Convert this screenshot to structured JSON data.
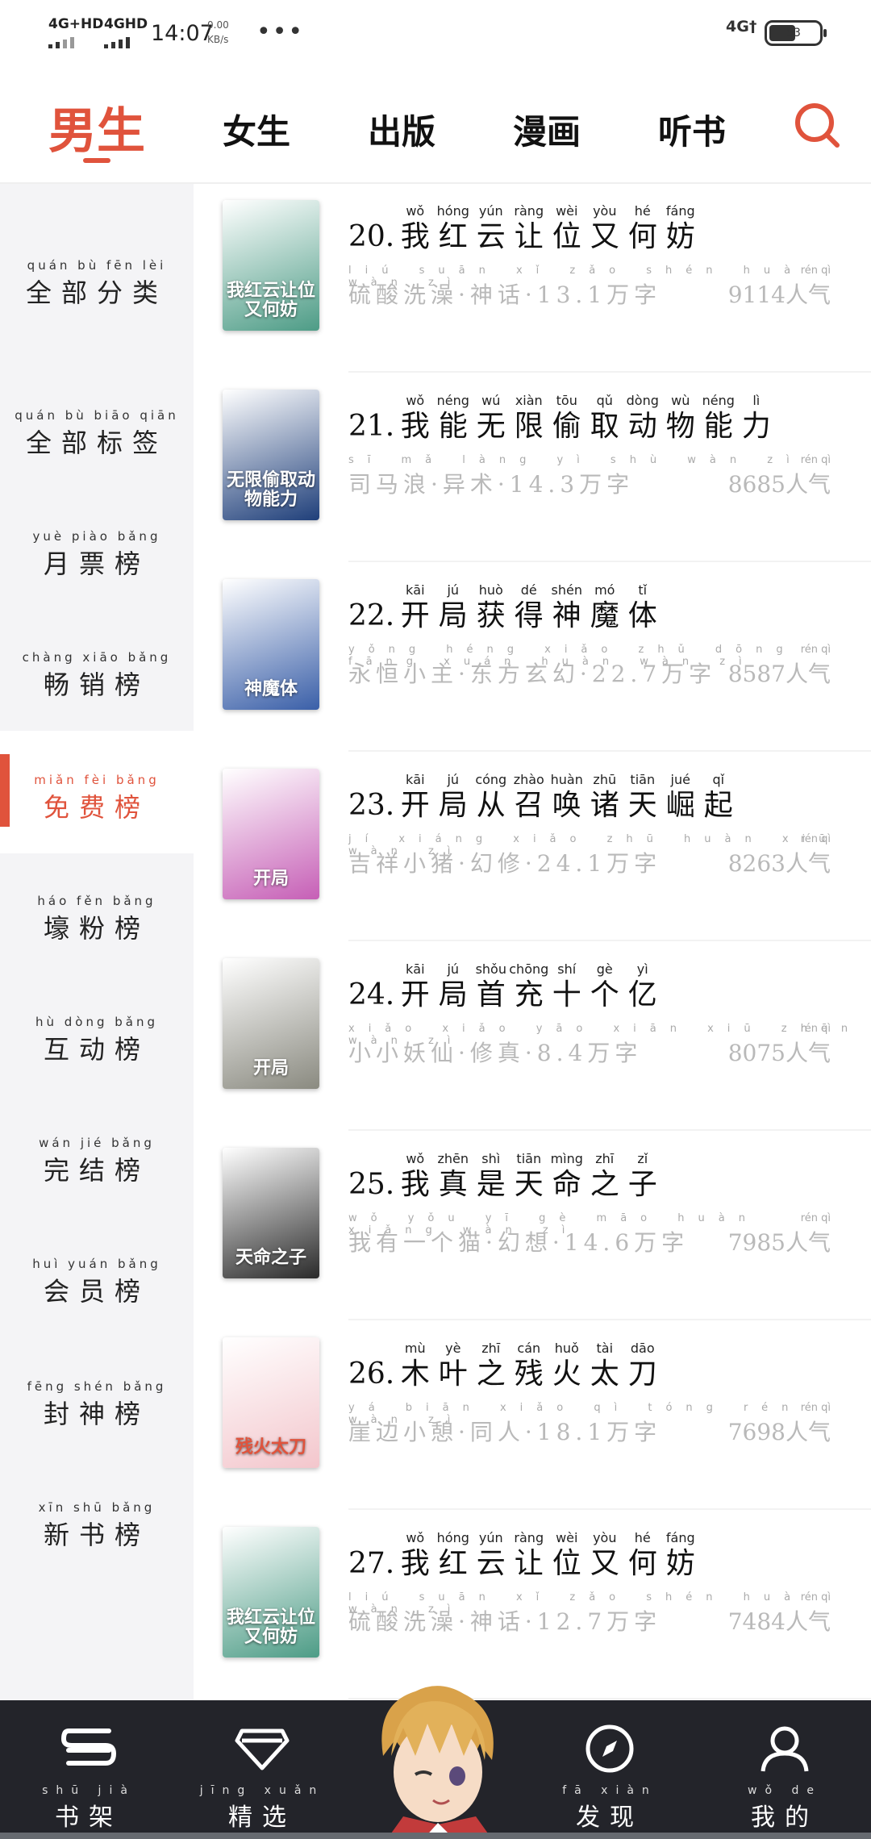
{
  "status_bar": {
    "net1": "4G+HD",
    "net2": "4GHD",
    "time": "14:07",
    "speed_value": "0.00",
    "speed_unit": "KB/s",
    "more": "•••",
    "mobile": "4G†",
    "battery": "53",
    "battery_level": 0.53
  },
  "tabs": [
    {
      "label": "男生"
    },
    {
      "label": "女生"
    },
    {
      "label": "出版"
    },
    {
      "label": "漫画"
    },
    {
      "label": "听书"
    }
  ],
  "sidebar": {
    "items": [
      {
        "pinyin": "quán bù fēn lèi",
        "label": "全部分类"
      },
      {
        "pinyin": "quán bù biāo qiān",
        "label": "全部标签"
      },
      {
        "pinyin": "yuè piào bǎng",
        "label": "月票榜"
      },
      {
        "pinyin": "chàng xiāo bǎng",
        "label": "畅销榜"
      },
      {
        "pinyin": "miǎn fèi bǎng",
        "label": "免费榜"
      },
      {
        "pinyin": "háo fěn bǎng",
        "label": "壕粉榜"
      },
      {
        "pinyin": "hù dòng bǎng",
        "label": "互动榜"
      },
      {
        "pinyin": "wán jié bǎng",
        "label": "完结榜"
      },
      {
        "pinyin": "huì yuán bǎng",
        "label": "会员榜"
      },
      {
        "pinyin": "fēng shén bǎng",
        "label": "封神榜"
      },
      {
        "pinyin": "xīn shū bǎng",
        "label": "新书榜"
      }
    ]
  },
  "books": [
    {
      "num": "20.",
      "title": "我红云让位又何妨",
      "title_py": [
        "wǒ",
        "hóng",
        "yún",
        "ràng",
        "wèi",
        "yòu",
        "hé",
        "fáng"
      ],
      "meta": "硫酸洗澡·神话·13.1万字",
      "meta_py": "liú suān xǐ zǎo shén huà wàn zì",
      "pop": "9114人气",
      "pop_py": "rén qì",
      "cover_text": "我红云让位又何妨",
      "cover_color": "#4d9c86"
    },
    {
      "num": "21.",
      "title": "我能无限偷取动物能力",
      "title_py": [
        "wǒ",
        "néng",
        "wú",
        "xiàn",
        "tōu",
        "qǔ",
        "dòng",
        "wù",
        "néng",
        "lì"
      ],
      "meta": "司马浪·异术·14.3万字",
      "meta_py": "sī mǎ làng yì shù wàn zì",
      "pop": "8685人气",
      "pop_py": "rén qì",
      "cover_text": "无限偷取动物能力",
      "cover_color": "#1f3f7a"
    },
    {
      "num": "22.",
      "title": "开局获得神魔体",
      "title_py": [
        "kāi",
        "jú",
        "huò",
        "dé",
        "shén",
        "mó",
        "tǐ"
      ],
      "meta": "永恒小主·东方玄幻·22.7万字",
      "meta_py": "yǒng héng xiǎo zhǔ dōng fāng xuán huàn wàn zì",
      "pop": "8587人气",
      "pop_py": "rén qì",
      "cover_text": "神魔体",
      "cover_color": "#3a5fa8"
    },
    {
      "num": "23.",
      "title": "开局从召唤诸天崛起",
      "title_py": [
        "kāi",
        "jú",
        "cóng",
        "zhào",
        "huàn",
        "zhū",
        "tiān",
        "jué",
        "qǐ"
      ],
      "meta": "吉祥小猪·幻修·24.1万字",
      "meta_py": "jí xiáng xiǎo zhū huàn xiū wàn zì",
      "pop": "8263人气",
      "pop_py": "rén qì",
      "cover_text": "开局",
      "cover_color": "#c65fb6"
    },
    {
      "num": "24.",
      "title": "开局首充十个亿",
      "title_py": [
        "kāi",
        "jú",
        "shǒu",
        "chōng",
        "shí",
        "gè",
        "yì"
      ],
      "meta": "小小妖仙·修真·8.4万字",
      "meta_py": "xiǎo xiǎo yāo xiān xiū zhēn wàn zì",
      "pop": "8075人气",
      "pop_py": "rén qì",
      "cover_text": "开局",
      "cover_color": "#8a8a80"
    },
    {
      "num": "25.",
      "title": "我真是天命之子",
      "title_py": [
        "wǒ",
        "zhēn",
        "shì",
        "tiān",
        "mìng",
        "zhī",
        "zǐ"
      ],
      "meta": "我有一个猫·幻想·14.6万字",
      "meta_py": "wǒ yǒu yī gè māo huàn xiǎng wàn zì",
      "pop": "7985人气",
      "pop_py": "rén qì",
      "cover_text": "天命之子",
      "cover_color": "#2a2a2a"
    },
    {
      "num": "26.",
      "title": "木叶之残火太刀",
      "title_py": [
        "mù",
        "yè",
        "zhī",
        "cán",
        "huǒ",
        "tài",
        "dāo"
      ],
      "meta": "崖边小憩·同人·18.1万字",
      "meta_py": "yá biān xiǎo qì tóng rén wàn zì",
      "pop": "7698人气",
      "pop_py": "rén qì",
      "cover_text": "残火太刀",
      "cover_color": "#f3c6cc"
    },
    {
      "num": "27.",
      "title": "我红云让位又何妨",
      "title_py": [
        "wǒ",
        "hóng",
        "yún",
        "ràng",
        "wèi",
        "yòu",
        "hé",
        "fáng"
      ],
      "meta": "硫酸洗澡·神话·12.7万字",
      "meta_py": "liú suān xǐ zǎo shén huà wàn zì",
      "pop": "7484人气",
      "pop_py": "rén qì",
      "cover_text": "我红云让位又何妨",
      "cover_color": "#4d9c86"
    }
  ],
  "bottom_nav": [
    {
      "pinyin": "shū jià",
      "label": "书架",
      "icon": "bookshelf-icon"
    },
    {
      "pinyin": "jīng xuǎn",
      "label": "精选",
      "icon": "diamond-icon"
    },
    {
      "pinyin": "fā xiàn",
      "label": "发现",
      "icon": "compass-icon"
    },
    {
      "pinyin": "wǒ de",
      "label": "我的",
      "icon": "person-icon"
    }
  ],
  "colors": {
    "accent": "#e0533c",
    "nav_bg": "#23242a",
    "sidebar_bg": "#f4f4f6"
  }
}
